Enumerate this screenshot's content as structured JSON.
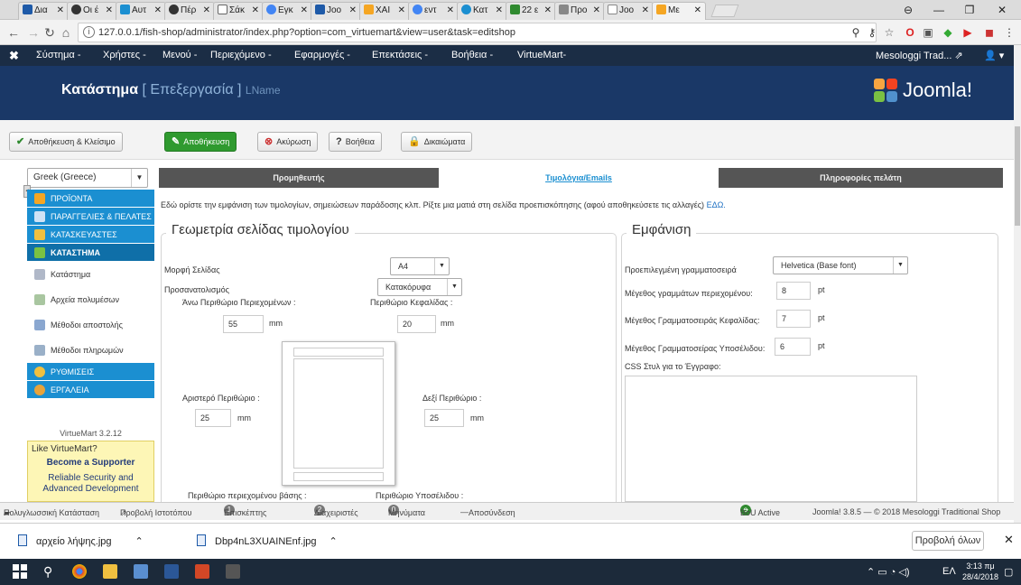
{
  "browser": {
    "tabs": [
      {
        "label": "Δια",
        "color": "#1e5aa8"
      },
      {
        "label": "Οι έ",
        "color": "#333333"
      },
      {
        "label": "Αυτ",
        "color": "#1b8fd1"
      },
      {
        "label": "Πέρ",
        "color": "#333333"
      },
      {
        "label": "Σάκ",
        "color": "#666666"
      },
      {
        "label": "Εγκ",
        "color": "#4285f4"
      },
      {
        "label": "Joo",
        "color": "#1e5aa8"
      },
      {
        "label": "ΧΑΙ",
        "color": "#f5a623"
      },
      {
        "label": "εντ",
        "color": "#4285f4"
      },
      {
        "label": "Κατ",
        "color": "#1b8fd1"
      },
      {
        "label": "22 ε",
        "color": "#2f8a2f"
      },
      {
        "label": "Προ",
        "color": "#888888"
      },
      {
        "label": "Joo",
        "color": "#888888"
      },
      {
        "label": "Με",
        "color": "#f5a623"
      }
    ],
    "url": "127.0.0.1/fish-shop/administrator/index.php?option=com_virtuemart&view=user&task=editshop"
  },
  "admin_nav": {
    "logo": "✖",
    "items": [
      "Σύστημα -",
      "Χρήστες -",
      "Μενού -",
      "Περιεχόμενο -",
      "Εφαρμογές -",
      "Επεκτάσεις -",
      "Βοήθεια -",
      "VirtueMart-"
    ],
    "site_link": "Mesologgi Trad...",
    "user_icon": "user-icon"
  },
  "header": {
    "title": "Κατάστημα",
    "subtitle": "[ Επεξεργασία ]",
    "name": "LName",
    "brand": "Joomla!"
  },
  "toolbar": {
    "save_close": "Αποθήκευση & Κλείσιμο",
    "save": "Αποθήκευση",
    "cancel": "Ακύρωση",
    "help": "Βοήθεια",
    "permissions": "Δικαιώματα"
  },
  "sidebar": {
    "language": "Greek (Greece)",
    "categories": [
      {
        "label": "ΠΡΟΪΟΝΤΑ",
        "icon": "products-icon"
      },
      {
        "label": "ΠΑΡΑΓΓΕΛΙΕΣ & ΠΕΛΑΤΕΣ",
        "icon": "orders-icon"
      },
      {
        "label": "ΚΑΤΑΣΚΕΥΑΣΤΕΣ",
        "icon": "manufacturers-icon"
      },
      {
        "label": "ΚΑΤΑΣΤΗΜΑ",
        "icon": "shop-icon"
      }
    ],
    "shop_items": [
      "Κατάστημα",
      "Αρχεία πολυμέσων",
      "Μέθοδοι αποστολής",
      "Μέθοδοι πληρωμών"
    ],
    "extra_categories": [
      "ΡΥΘΜΙΣΕΙΣ",
      "ΕΡΓΑΛΕΙΑ"
    ],
    "version": "VirtueMart 3.2.12",
    "promo": {
      "line1": "Like VirtueMart?",
      "line2": "Become a Supporter",
      "line3": "Reliable Security and Advanced Development"
    }
  },
  "main": {
    "tabs": [
      "Προμηθευτής",
      "Τιμολόγια/Emails",
      "Πληροφορίες πελάτη"
    ],
    "description": "Εδώ ορίστε την εμφάνιση των τιμολογίων, σημειώσεων παράδοσης κλπ. Ρίξτε μια ματιά στη σελίδα προεπισκόπησης (αφού αποθηκεύσετε τις αλλαγές)",
    "description_link": "ΕΔΩ.",
    "geometry": {
      "legend": "Γεωμετρία σελίδας τιμολογίου",
      "page_format_label": "Μορφή Σελίδας",
      "page_format_value": "A4",
      "orientation_label": "Προσανατολισμός",
      "orientation_value": "Κατακόρυφα",
      "top_margin_label": "Άνω Περιθώριο Περιεχομένων :",
      "top_margin_value": "55",
      "header_margin_label": "Περιθώριο Κεφαλίδας :",
      "header_margin_value": "20",
      "left_margin_label": "Αριστερό Περιθώριο :",
      "left_margin_value": "25",
      "right_margin_label": "Δεξί Περιθώριο :",
      "right_margin_value": "25",
      "bottom_margin_label": "Περιθώριο περιεχομένου βάσης :",
      "footer_margin_label": "Περιθώριο Υποσέλιδου :",
      "unit": "mm"
    },
    "appearance": {
      "legend": "Εμφάνιση",
      "font_label": "Προεπιλεγμένη γραμματοσειρά",
      "font_value": "Helvetica (Base font)",
      "content_size_label": "Μέγεθος γραμμάτων περιεχομένου:",
      "content_size_value": "8",
      "header_size_label": "Μέγεθος Γραμματοσειράς Κεφαλίδας:",
      "header_size_value": "7",
      "footer_size_label": "Μέγεθος Γραμματοσείρας Υποσέλιδου:",
      "footer_size_value": "6",
      "unit": "pt",
      "css_label": "CSS Στυλ για το Έγγραφο:"
    }
  },
  "statusbar": {
    "multilingual": "Πολυγλωσσική Κατάσταση",
    "view_site": "Προβολή Ιστοτόπου",
    "visitors_count": "1",
    "visitors": "Επισκέπτης",
    "admins_count": "2",
    "admins": "Διαχειριστές",
    "messages_count": "0",
    "messages": "Μηνύματα",
    "logout": "Αποσύνδεση",
    "bou": "BoU Active",
    "copyright": "Joomla! 3.8.5 — © 2018 Mesologgi Traditional Shop"
  },
  "downloads": {
    "file1": "αρχείο λήψης.jpg",
    "file2": "Dbp4nL3XUAINEnf.jpg",
    "show_all": "Προβολή όλων"
  },
  "taskbar": {
    "lang": "ΕΛ",
    "time": "3:13 πμ",
    "date": "28/4/2018"
  }
}
